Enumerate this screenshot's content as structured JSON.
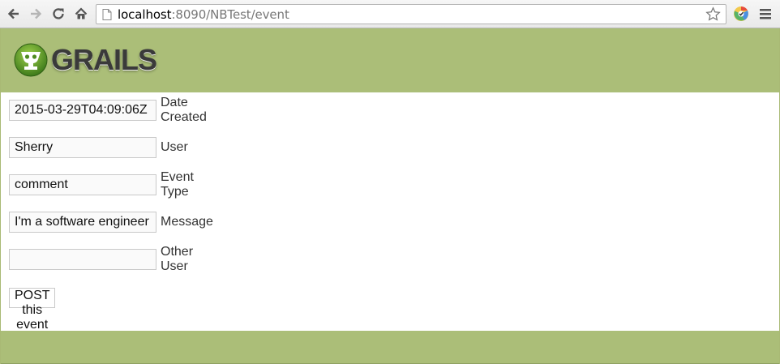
{
  "browser": {
    "url_host": "localhost",
    "url_rest": ":8090/NBTest/event",
    "back_icon": "arrow-left-icon",
    "forward_icon": "arrow-right-icon",
    "reload_icon": "reload-icon",
    "home_icon": "home-icon"
  },
  "header": {
    "logo_text": "GRAILS"
  },
  "form": {
    "fields": [
      {
        "value": "2015-03-29T04:09:06Z",
        "label": "Date Created"
      },
      {
        "value": "Sherry",
        "label": "User"
      },
      {
        "value": "comment",
        "label": "Event Type"
      },
      {
        "value": "I'm a software engineer",
        "label": "Message"
      },
      {
        "value": "",
        "label": "Other User"
      }
    ],
    "submit_label": "POST this event"
  },
  "colors": {
    "header_bg": "#abbe78",
    "footer_bg": "#abbe78"
  }
}
